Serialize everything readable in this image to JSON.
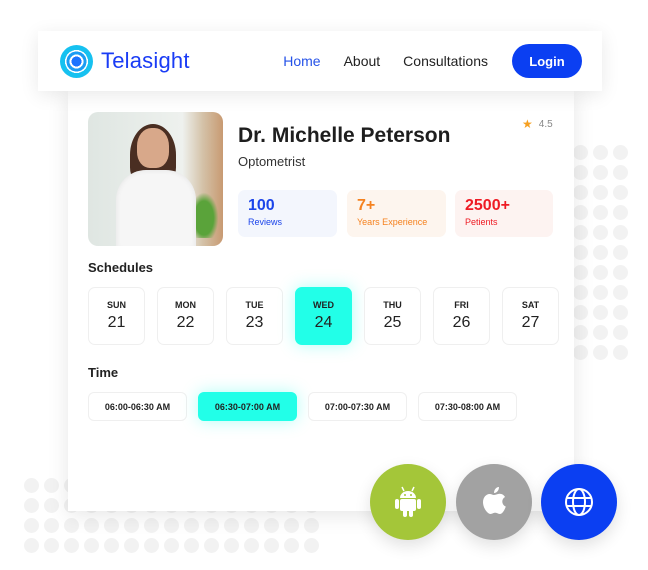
{
  "navbar": {
    "brand": "Telasight",
    "links": [
      {
        "label": "Home",
        "active": true
      },
      {
        "label": "About",
        "active": false
      },
      {
        "label": "Consultations",
        "active": false
      }
    ],
    "login_label": "Login"
  },
  "doctor": {
    "name": "Dr. Michelle Peterson",
    "specialty": "Optometrist",
    "rating": "4.5",
    "stats": [
      {
        "value": "100",
        "label": "Reviews",
        "color": "#1c45ea"
      },
      {
        "value": "7+",
        "label": "Years Experience",
        "color": "#f5821f"
      },
      {
        "value": "2500+",
        "label": "Petients",
        "color": "#ee1b24"
      }
    ]
  },
  "schedules": {
    "title": "Schedules",
    "days": [
      {
        "name": "SUN",
        "date": "21",
        "selected": false
      },
      {
        "name": "MON",
        "date": "22",
        "selected": false
      },
      {
        "name": "TUE",
        "date": "23",
        "selected": false
      },
      {
        "name": "WED",
        "date": "24",
        "selected": true
      },
      {
        "name": "THU",
        "date": "25",
        "selected": false
      },
      {
        "name": "FRI",
        "date": "26",
        "selected": false
      },
      {
        "name": "SAT",
        "date": "27",
        "selected": false
      }
    ]
  },
  "time": {
    "title": "Time",
    "slots": [
      {
        "label": "06:00-06:30 AM",
        "selected": false
      },
      {
        "label": "06:30-07:00 AM",
        "selected": true
      },
      {
        "label": "07:00-07:30 AM",
        "selected": false
      },
      {
        "label": "07:30-08:00 AM",
        "selected": false
      }
    ]
  },
  "platforms": [
    {
      "icon": "android-icon",
      "color": "#a4c639"
    },
    {
      "icon": "apple-icon",
      "color": "#a2a2a2"
    },
    {
      "icon": "globe-icon",
      "color": "#0b3ff2"
    }
  ],
  "colors": {
    "brand": "#0b3ff2",
    "accent": "#22ffe8"
  }
}
